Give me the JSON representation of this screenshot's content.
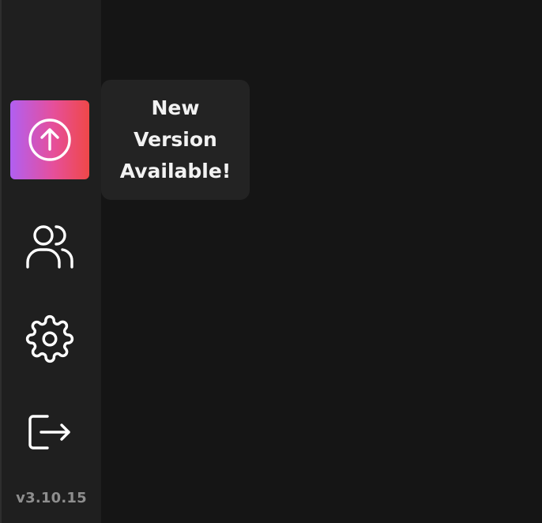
{
  "sidebar": {
    "update": {
      "icon": "arrow-up-circle-icon",
      "gradient": [
        "#b15ff2",
        "#e64f9a",
        "#ef4848"
      ]
    },
    "items": [
      {
        "id": "users",
        "icon": "users-icon"
      },
      {
        "id": "settings",
        "icon": "gear-icon"
      },
      {
        "id": "logout",
        "icon": "logout-icon"
      }
    ],
    "version": "v3.10.15"
  },
  "tooltip": {
    "text": "New Version Available!"
  },
  "colors": {
    "background": "#151515",
    "sidebar": "#1f1f1f",
    "tooltip": "#232323",
    "icon": "#ffffff",
    "version_text": "#8e8e8e"
  }
}
